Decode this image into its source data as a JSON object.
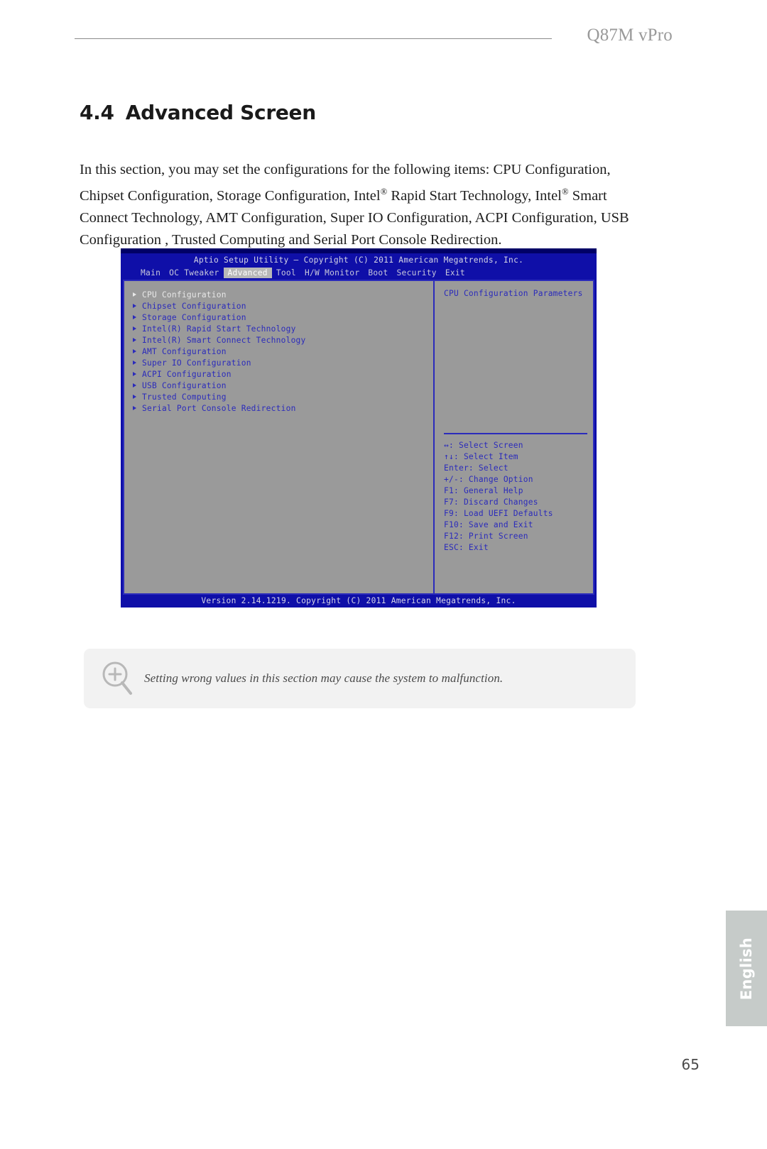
{
  "header": {
    "model": "Q87M vPro"
  },
  "section": {
    "number": "4.4",
    "title": "Advanced Screen",
    "intro_part1": "In this section, you may set the configurations for the following items: CPU Configuration, Chipset Configuration, Storage Configuration, Intel",
    "intro_reg1": "®",
    "intro_part2": " Rapid Start Technology, Intel",
    "intro_reg2": "®",
    "intro_part3": " Smart Connect Technology, AMT Configuration, Super IO Configuration, ACPI Configuration, USB Configuration , Trusted Computing and Serial Port Console Redirection."
  },
  "bios": {
    "title": "Aptio Setup Utility – Copyright (C) 2011 American Megatrends, Inc.",
    "menu": [
      {
        "label": "Main",
        "active": false
      },
      {
        "label": "OC Tweaker",
        "active": false
      },
      {
        "label": "Advanced",
        "active": true
      },
      {
        "label": "Tool",
        "active": false
      },
      {
        "label": "H/W Monitor",
        "active": false
      },
      {
        "label": "Boot",
        "active": false
      },
      {
        "label": "Security",
        "active": false
      },
      {
        "label": "Exit",
        "active": false
      }
    ],
    "items": [
      {
        "label": "CPU Configuration",
        "selected": true
      },
      {
        "label": "Chipset Configuration",
        "selected": false
      },
      {
        "label": "Storage Configuration",
        "selected": false
      },
      {
        "label": "Intel(R) Rapid Start Technology",
        "selected": false
      },
      {
        "label": "Intel(R) Smart Connect Technology",
        "selected": false
      },
      {
        "label": "AMT Configuration",
        "selected": false
      },
      {
        "label": "Super IO Configuration",
        "selected": false
      },
      {
        "label": "ACPI Configuration",
        "selected": false
      },
      {
        "label": "USB Configuration",
        "selected": false
      },
      {
        "label": "Trusted Computing",
        "selected": false
      },
      {
        "label": "Serial Port Console Redirection",
        "selected": false
      }
    ],
    "help_title": "CPU Configuration Parameters",
    "help_keys": [
      "↔: Select Screen",
      "↑↓: Select Item",
      "Enter: Select",
      "+/-: Change Option",
      "F1: General Help",
      "F7: Discard Changes",
      "F9: Load UEFI Defaults",
      "F10: Save and Exit",
      "F12: Print Screen",
      "ESC: Exit"
    ],
    "footer": "Version 2.14.1219. Copyright (C) 2011 American Megatrends, Inc."
  },
  "note": {
    "icon": "magnifier-plus-icon",
    "text": "Setting wrong values in this section may cause the system to malfunction."
  },
  "language_tab": {
    "label": "English"
  },
  "page_number": "65"
}
